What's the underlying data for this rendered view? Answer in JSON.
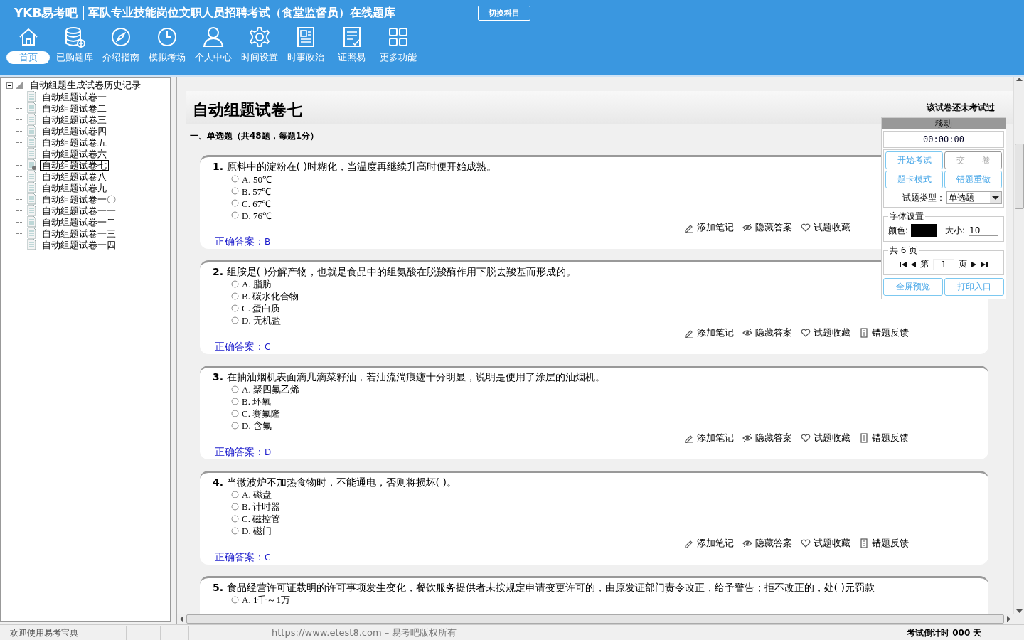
{
  "header": {
    "logo": "YKB易考吧",
    "title": "军队专业技能岗位文职人员招聘考试（食堂监督员）在线题库",
    "switch_button": "切换科目",
    "nav": [
      {
        "label": "首页",
        "selected": true
      },
      {
        "label": "已购题库",
        "selected": false
      },
      {
        "label": "介绍指南",
        "selected": false
      },
      {
        "label": "模拟考场",
        "selected": false
      },
      {
        "label": "个人中心",
        "selected": false
      },
      {
        "label": "时间设置",
        "selected": false
      },
      {
        "label": "时事政治",
        "selected": false
      },
      {
        "label": "证照易",
        "selected": false
      },
      {
        "label": "更多功能",
        "selected": false
      }
    ]
  },
  "tree": {
    "label": "自动组题生成试卷历史记录",
    "expanded": true,
    "children": [
      {
        "label": "自动组题试卷一",
        "selected": false
      },
      {
        "label": "自动组题试卷二",
        "selected": false
      },
      {
        "label": "自动组题试卷三",
        "selected": false
      },
      {
        "label": "自动组题试卷四",
        "selected": false
      },
      {
        "label": "自动组题试卷五",
        "selected": false
      },
      {
        "label": "自动组题试卷六",
        "selected": false
      },
      {
        "label": "自动组题试卷七",
        "selected": true
      },
      {
        "label": "自动组题试卷八",
        "selected": false
      },
      {
        "label": "自动组题试卷九",
        "selected": false
      },
      {
        "label": "自动组题试卷一〇",
        "selected": false
      },
      {
        "label": "自动组题试卷一一",
        "selected": false
      },
      {
        "label": "自动组题试卷一二",
        "selected": false
      },
      {
        "label": "自动组题试卷一三",
        "selected": false
      },
      {
        "label": "自动组题试卷一四",
        "selected": false
      }
    ]
  },
  "paper": {
    "title": "自动组题试卷七",
    "status": "该试卷还未考试过",
    "section": "一、单选题（共48题，每题1分）",
    "questions": [
      {
        "number": "1.",
        "text": "原料中的淀粉在( )时糊化，当温度再继续升高时便开始成熟。",
        "options": [
          {
            "letter": "A.",
            "text": "50℃",
            "checked": false
          },
          {
            "letter": "B.",
            "text": "57℃",
            "checked": false
          },
          {
            "letter": "C.",
            "text": "67℃",
            "checked": false
          },
          {
            "letter": "D.",
            "text": "76℃",
            "checked": false
          }
        ],
        "answer_label": "正确答案：",
        "answer": "B",
        "tools": [
          "添加笔记",
          "隐藏答案",
          "试题收藏"
        ]
      },
      {
        "number": "2.",
        "text": "组胺是( )分解产物，也就是食品中的组氨酸在脱羧酶作用下脱去羧基而形成的。",
        "options": [
          {
            "letter": "A.",
            "text": "脂肪",
            "checked": false
          },
          {
            "letter": "B.",
            "text": "碳水化合物",
            "checked": false
          },
          {
            "letter": "C.",
            "text": "蛋白质",
            "checked": false
          },
          {
            "letter": "D.",
            "text": "无机盐",
            "checked": false
          }
        ],
        "answer_label": "正确答案：",
        "answer": "C",
        "tools": [
          "添加笔记",
          "隐藏答案",
          "试题收藏",
          "错题反馈"
        ]
      },
      {
        "number": "3.",
        "text": "在抽油烟机表面滴几滴菜籽油，若油流淌痕迹十分明显，说明是使用了涂层的油烟机。",
        "options": [
          {
            "letter": "A.",
            "text": "聚四氟乙烯",
            "checked": false
          },
          {
            "letter": "B.",
            "text": "环氧",
            "checked": false
          },
          {
            "letter": "C.",
            "text": "赛氟隆",
            "checked": false
          },
          {
            "letter": "D.",
            "text": "含氟",
            "checked": false
          }
        ],
        "answer_label": "正确答案：",
        "answer": "D",
        "tools": [
          "添加笔记",
          "隐藏答案",
          "试题收藏",
          "错题反馈"
        ]
      },
      {
        "number": "4.",
        "text": "当微波炉不加热食物时，不能通电，否则将损坏( )。",
        "options": [
          {
            "letter": "A.",
            "text": "磁盘",
            "checked": false
          },
          {
            "letter": "B.",
            "text": "计时器",
            "checked": false
          },
          {
            "letter": "C.",
            "text": "磁控管",
            "checked": false
          },
          {
            "letter": "D.",
            "text": "磁门",
            "checked": false
          }
        ],
        "answer_label": "正确答案：",
        "answer": "C",
        "tools": [
          "添加笔记",
          "隐藏答案",
          "试题收藏",
          "错题反馈"
        ]
      },
      {
        "number": "5.",
        "text": "食品经营许可证载明的许可事项发生变化，餐饮服务提供者未按规定申请变更许可的，由原发证部门责令改正，给予警告；拒不改正的，处( )元罚款",
        "options": [
          {
            "letter": "A.",
            "text": "1千～1万",
            "checked": false
          }
        ]
      }
    ]
  },
  "panel": {
    "header": "移动",
    "timer": "00:00:00",
    "buttons": [
      {
        "label": "开始考试",
        "disabled": false
      },
      {
        "label": "交　　卷",
        "disabled": true
      },
      {
        "label": "题卡模式",
        "disabled": false
      },
      {
        "label": "错题重做",
        "disabled": false
      }
    ],
    "type_label": "试题类型：",
    "type_value": "单选题",
    "font_group": "字体设置",
    "color_label": "颜色:",
    "swatch": {
      "color": "#000000"
    },
    "size_label": "大小:",
    "size": "10",
    "pages": "共 6 页",
    "page_prefix": "第",
    "page": "1",
    "page_suffix": "页",
    "bottom_buttons": [
      {
        "label": "全屏预览",
        "disabled": false
      },
      {
        "label": "打印入口",
        "disabled": false
      }
    ]
  },
  "status_bar": [
    "欢迎使用易考宝典",
    "https://www.etest8.com – 易考吧版权所有",
    "考试倒计时 000 天"
  ]
}
